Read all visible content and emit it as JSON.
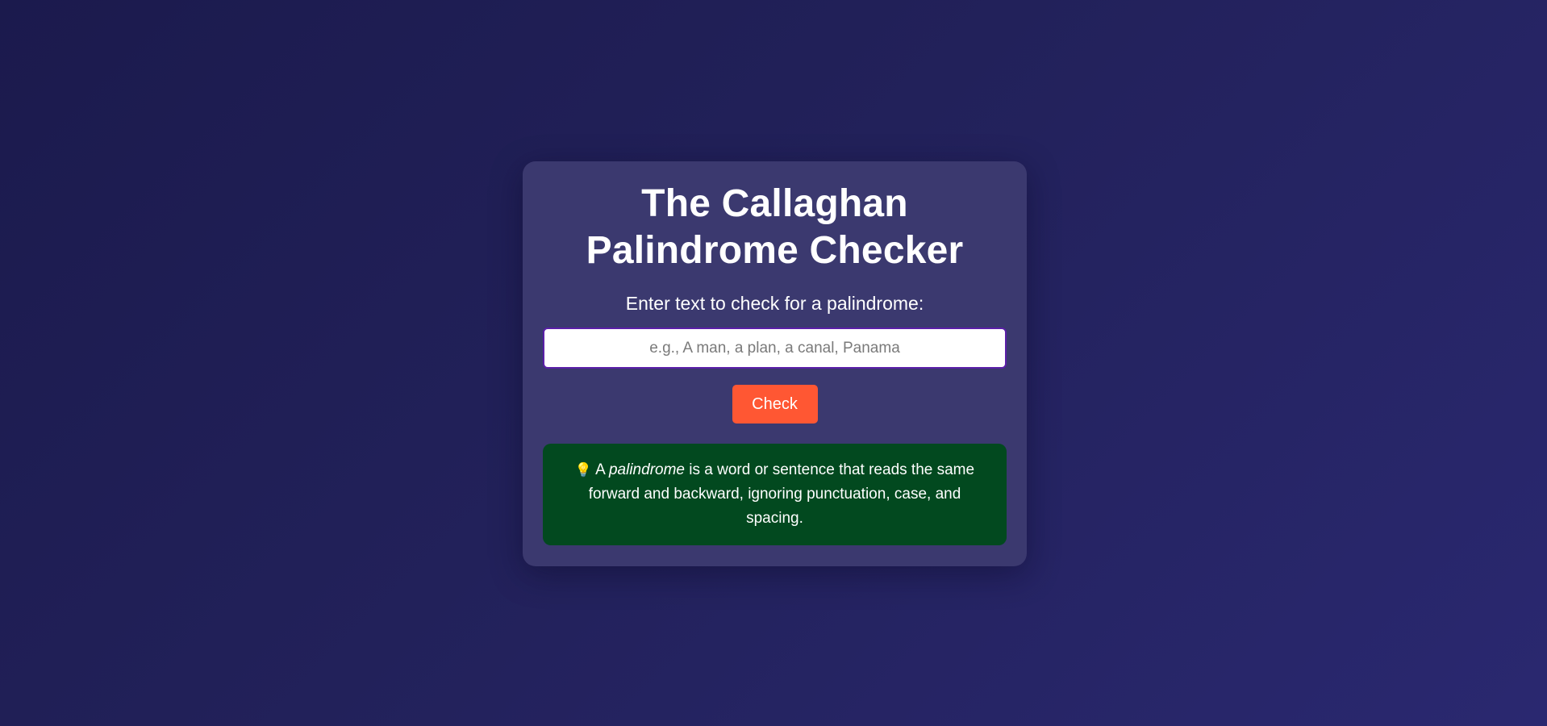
{
  "card": {
    "title": "The Callaghan Palindrome Checker",
    "prompt_label": "Enter text to check for a palindrome:",
    "input": {
      "value": "",
      "placeholder": "e.g., A man, a plan, a canal, Panama"
    },
    "check_button_label": "Check",
    "info": {
      "icon": "lightbulb-icon",
      "icon_glyph": "💡",
      "prefix": "A ",
      "term": "palindrome",
      "definition": " is a word or sentence that reads the same forward and backward, ignoring punctuation, case, and spacing."
    }
  },
  "colors": {
    "background": "#22215a",
    "card": "#3b396f",
    "input_border": "#5b1fa8",
    "button": "#ff5733",
    "info_box": "#02491f"
  }
}
